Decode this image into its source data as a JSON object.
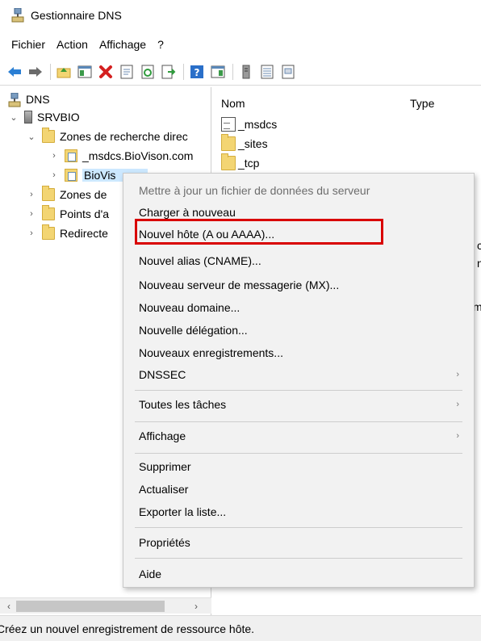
{
  "window": {
    "title": "Gestionnaire DNS"
  },
  "menubar": {
    "items": [
      "Fichier",
      "Action",
      "Affichage",
      "?"
    ]
  },
  "toolbar": {
    "icons": [
      "back-arrow-icon",
      "forward-arrow-icon",
      "up-folder-icon",
      "console-tree-icon",
      "delete-icon",
      "properties-icon",
      "refresh-icon",
      "export-icon",
      "help-icon",
      "view-icon",
      "server-icon",
      "list-icon",
      "document-icon"
    ]
  },
  "tree": {
    "root": "DNS",
    "server": "SRVBIO",
    "forward_zones": "Zones de recherche direc",
    "zone_msdcs": "_msdcs.BioVison.com",
    "zone_biovis": "BioVis",
    "reverse_zones": "Zones de",
    "trust_points": "Points d'a",
    "forwarders": "Redirecte"
  },
  "list": {
    "col_name": "Nom",
    "col_type": "Type",
    "rows": [
      "_msdcs",
      "_sites",
      "_tcp"
    ],
    "fragments": [
      "c",
      "n",
      "m"
    ]
  },
  "context_menu": {
    "items": [
      {
        "label": "Mettre à jour un fichier de données du serveur",
        "disabled": true
      },
      {
        "label": "Charger à nouveau"
      },
      {
        "label": "Nouvel hôte (A ou AAAA)..."
      },
      {
        "label": "Nouvel alias (CNAME)..."
      },
      {
        "label": "Nouveau serveur de messagerie (MX)..."
      },
      {
        "label": "Nouveau domaine..."
      },
      {
        "label": "Nouvelle délégation..."
      },
      {
        "label": "Nouveaux enregistrements..."
      },
      {
        "label": "DNSSEC",
        "submenu": true
      },
      {
        "label": "Toutes les tâches",
        "submenu": true
      },
      {
        "label": "Affichage",
        "submenu": true
      },
      {
        "label": "Supprimer"
      },
      {
        "label": "Actualiser"
      },
      {
        "label": "Exporter la liste..."
      },
      {
        "label": "Propriétés"
      },
      {
        "label": "Aide"
      }
    ],
    "submenu_arrow": "›",
    "highlight_color": "#d90000"
  },
  "scrollbar": {
    "left_arrow": "‹",
    "right_arrow": "›"
  },
  "status": {
    "text": "Créez un nouvel enregistrement de ressource hôte."
  }
}
